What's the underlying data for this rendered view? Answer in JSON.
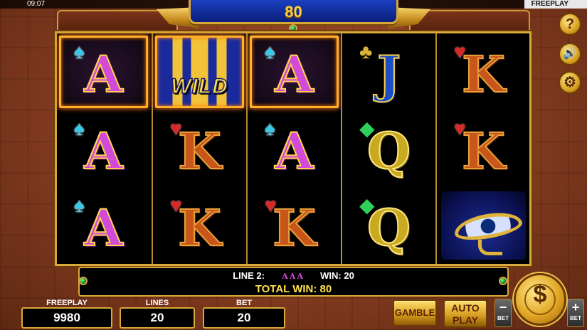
{
  "status_bar": {
    "time": "09:07",
    "mode": "FREEPLAY"
  },
  "header": {
    "win_display": "80"
  },
  "reels": [
    [
      {
        "symbol": "A",
        "suit": "spade",
        "highlighted": true
      },
      {
        "symbol": "A",
        "suit": "spade",
        "highlighted": false
      },
      {
        "symbol": "A",
        "suit": "spade",
        "highlighted": false
      }
    ],
    [
      {
        "symbol": "WILD",
        "highlighted": true
      },
      {
        "symbol": "K",
        "suit": "heart",
        "highlighted": false
      },
      {
        "symbol": "K",
        "suit": "heart",
        "highlighted": false
      }
    ],
    [
      {
        "symbol": "A",
        "suit": "spade",
        "highlighted": true
      },
      {
        "symbol": "A",
        "suit": "spade",
        "highlighted": false
      },
      {
        "symbol": "K",
        "suit": "heart",
        "highlighted": false
      }
    ],
    [
      {
        "symbol": "J",
        "suit": "club",
        "highlighted": false
      },
      {
        "symbol": "Q",
        "suit": "diamond",
        "highlighted": false
      },
      {
        "symbol": "Q",
        "suit": "diamond",
        "highlighted": false
      }
    ],
    [
      {
        "symbol": "K",
        "suit": "heart",
        "highlighted": false
      },
      {
        "symbol": "K",
        "suit": "heart",
        "highlighted": false
      },
      {
        "symbol": "EYE_OF_HORUS",
        "highlighted": false
      }
    ]
  ],
  "symbol_text": {
    "wild": "WILD"
  },
  "info_bar": {
    "line_label": "LINE 2:",
    "line_symbols": [
      "A",
      "A",
      "A"
    ],
    "win_label": "WIN: 20",
    "total_label": "TOTAL WIN: 80"
  },
  "bottom": {
    "freeplay_label": "FREEPLAY",
    "freeplay_value": "9980",
    "lines_label": "LINES",
    "lines_value": "20",
    "bet_label": "BET",
    "bet_value": "20",
    "gamble_label": "GAMBLE",
    "auto_label_1": "AUTO",
    "auto_label_2": "PLAY",
    "bet_minus_symbol": "−",
    "bet_minus_label": "BET",
    "bet_plus_symbol": "+",
    "bet_plus_label": "BET",
    "spin_symbol": "$"
  },
  "side_buttons": {
    "help_symbol": "?",
    "sound_symbol": "🔊",
    "settings_symbol": "⚙"
  },
  "icons": {
    "help": "question-icon",
    "sound": "speaker-icon",
    "settings": "gear-icon",
    "spin": "money-bag-icon"
  },
  "colors": {
    "gold": "#d8a83a",
    "header_blue": "#1a3fc0",
    "win_text": "#ffe24a",
    "highlight": "#ffb02a",
    "background": "#8a3f22"
  }
}
